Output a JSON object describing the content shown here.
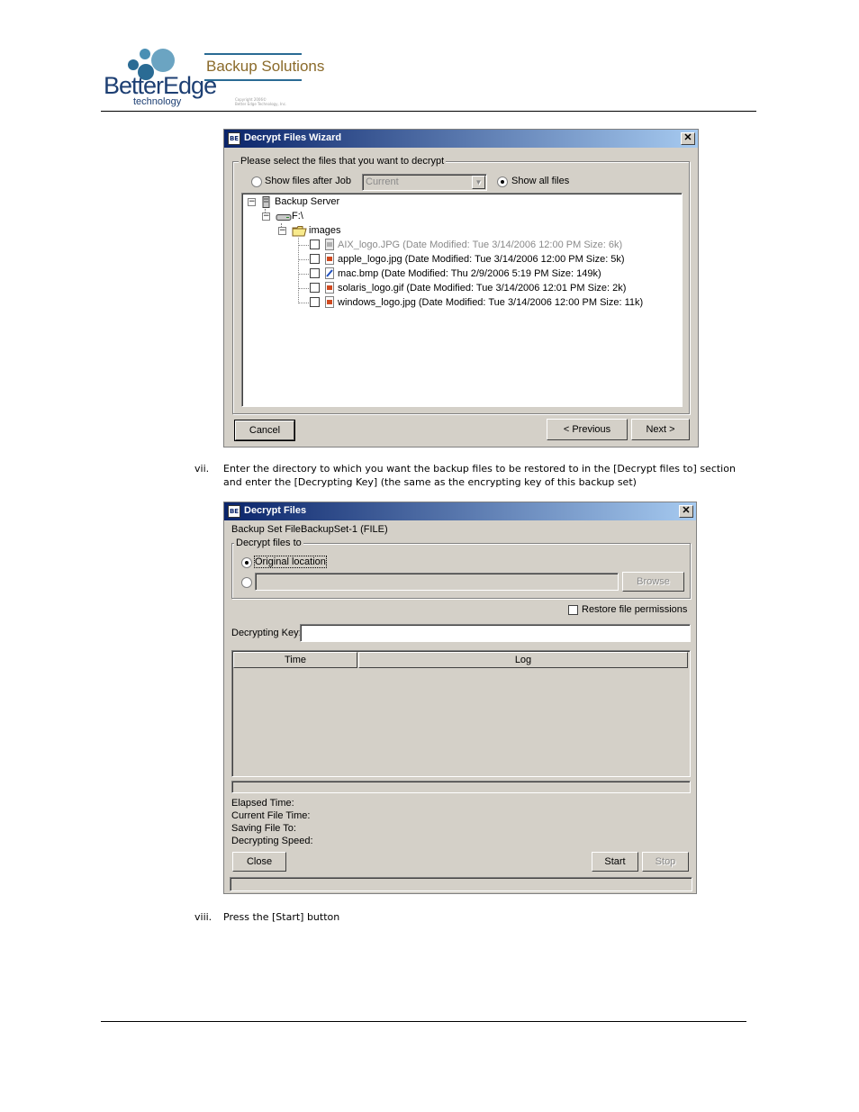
{
  "header": {
    "logo_word": "BetterEdge",
    "logo_sub": "technology",
    "product": "Backup Solutions",
    "copyright_line1": "Copyright 2006©",
    "copyright_line2": "Better Edge Technology, Inc."
  },
  "wizard": {
    "title": "Decrypt Files Wizard",
    "close_glyph": "✕",
    "group_label": "Please select the files that you want to decrypt",
    "radio_job_label": "Show files after Job",
    "job_select_value": "Current",
    "radio_all_label": "Show all files",
    "selected_radio": "all",
    "tree": {
      "root": "Backup Server",
      "drive": "F:\\",
      "folder": "images",
      "files": [
        {
          "label": "AIX_logo.JPG (Date Modified: Tue 3/14/2006 12:00 PM Size: 6k)",
          "dimmed": true
        },
        {
          "label": "apple_logo.jpg (Date Modified: Tue 3/14/2006 12:00 PM Size: 5k)",
          "dimmed": false
        },
        {
          "label": "mac.bmp (Date Modified: Thu 2/9/2006 5:19 PM Size: 149k)",
          "dimmed": false
        },
        {
          "label": "solaris_logo.gif (Date Modified: Tue 3/14/2006 12:01 PM Size: 2k)",
          "dimmed": false
        },
        {
          "label": "windows_logo.jpg (Date Modified: Tue 3/14/2006 12:00 PM Size: 11k)",
          "dimmed": false
        }
      ]
    },
    "cancel_label": "Cancel",
    "previous_label": "< Previous",
    "next_label": "Next >"
  },
  "step_vii": {
    "marker": "vii.",
    "text": "Enter the directory to which you want the backup files to be restored to in the [Decrypt files to] section and enter the [Decrypting Key] (the same as the encrypting key of this backup set)"
  },
  "decrypt": {
    "title": "Decrypt Files",
    "close_glyph": "✕",
    "backup_set": "Backup Set FileBackupSet-1 (FILE)",
    "group_label": "Decrypt files to",
    "original_location_label": "Original location",
    "selected_radio": "original",
    "path_value": "",
    "browse_label": "Browse",
    "restore_permissions_label": "Restore file permissions",
    "key_label": "Decrypting Key:",
    "key_value": "",
    "col_time": "Time",
    "col_log": "Log",
    "elapsed_label": "Elapsed Time:",
    "current_file_time_label": "Current File Time:",
    "saving_to_label": "Saving File To:",
    "speed_label": "Decrypting Speed:",
    "close_label": "Close",
    "start_label": "Start",
    "stop_label": "Stop"
  },
  "step_viii": {
    "marker": "viii.",
    "text": "Press the [Start] button"
  }
}
